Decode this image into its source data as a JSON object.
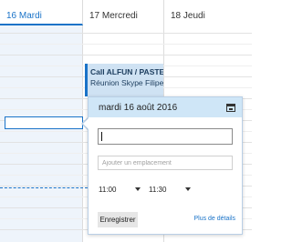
{
  "days": [
    {
      "label": "16 Mardi"
    },
    {
      "label": "17 Mercredi"
    },
    {
      "label": "18 Jeudi"
    }
  ],
  "event": {
    "title": "Call ALFUN / PASTEUR I",
    "subtitle": "Réunion Skype Filipe DC"
  },
  "popup": {
    "date": "mardi 16 août 2016",
    "title_value": "",
    "location_placeholder": "Ajouter un emplacement",
    "start_time": "11:00",
    "end_time": "11:30",
    "save_label": "Enregistrer",
    "details_label": "Plus de détails"
  },
  "icons": {
    "calendar": "calendar-icon",
    "dropdown": "chevron-down-icon"
  },
  "colors": {
    "accent": "#1a73c8",
    "header_bg": "#cfe6f7",
    "event_bg": "#cfe2f3",
    "today_bg": "#eef4fb"
  }
}
